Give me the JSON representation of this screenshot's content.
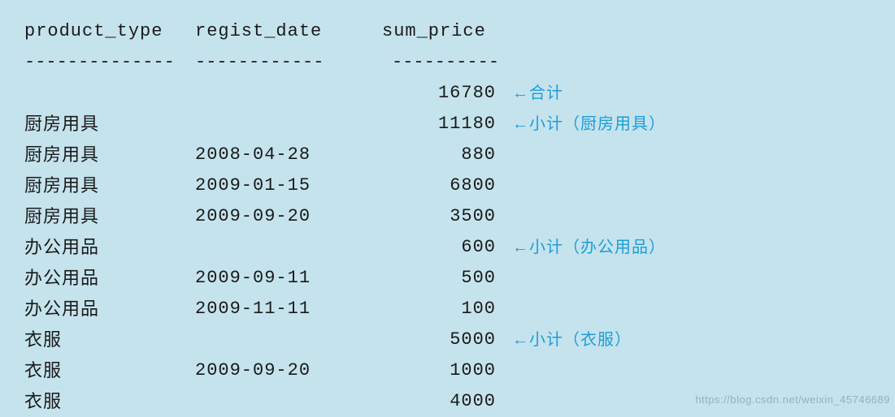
{
  "headers": {
    "product_type": "product_type",
    "regist_date": "regist_date",
    "sum_price": "sum_price"
  },
  "dashes": {
    "product_type": "--------------",
    "regist_date": "------------",
    "sum_price": "----------"
  },
  "rows": [
    {
      "product_type": "",
      "regist_date": "",
      "sum_price": "16780",
      "annotation": "←合计"
    },
    {
      "product_type": "厨房用具",
      "regist_date": "",
      "sum_price": "11180",
      "annotation": "←小计（厨房用具）"
    },
    {
      "product_type": "厨房用具",
      "regist_date": "2008-04-28",
      "sum_price": "880",
      "annotation": ""
    },
    {
      "product_type": "厨房用具",
      "regist_date": "2009-01-15",
      "sum_price": "6800",
      "annotation": ""
    },
    {
      "product_type": "厨房用具",
      "regist_date": "2009-09-20",
      "sum_price": "3500",
      "annotation": ""
    },
    {
      "product_type": "办公用品",
      "regist_date": "",
      "sum_price": "600",
      "annotation": "←小计（办公用品）"
    },
    {
      "product_type": "办公用品",
      "regist_date": "2009-09-11",
      "sum_price": "500",
      "annotation": ""
    },
    {
      "product_type": "办公用品",
      "regist_date": "2009-11-11",
      "sum_price": "100",
      "annotation": ""
    },
    {
      "product_type": "衣服",
      "regist_date": "",
      "sum_price": "5000",
      "annotation": "←小计（衣服）"
    },
    {
      "product_type": "衣服",
      "regist_date": "2009-09-20",
      "sum_price": "1000",
      "annotation": ""
    },
    {
      "product_type": "衣服",
      "regist_date": "",
      "sum_price": "4000",
      "annotation": ""
    }
  ],
  "watermark": "https://blog.csdn.net/weixin_45746689"
}
